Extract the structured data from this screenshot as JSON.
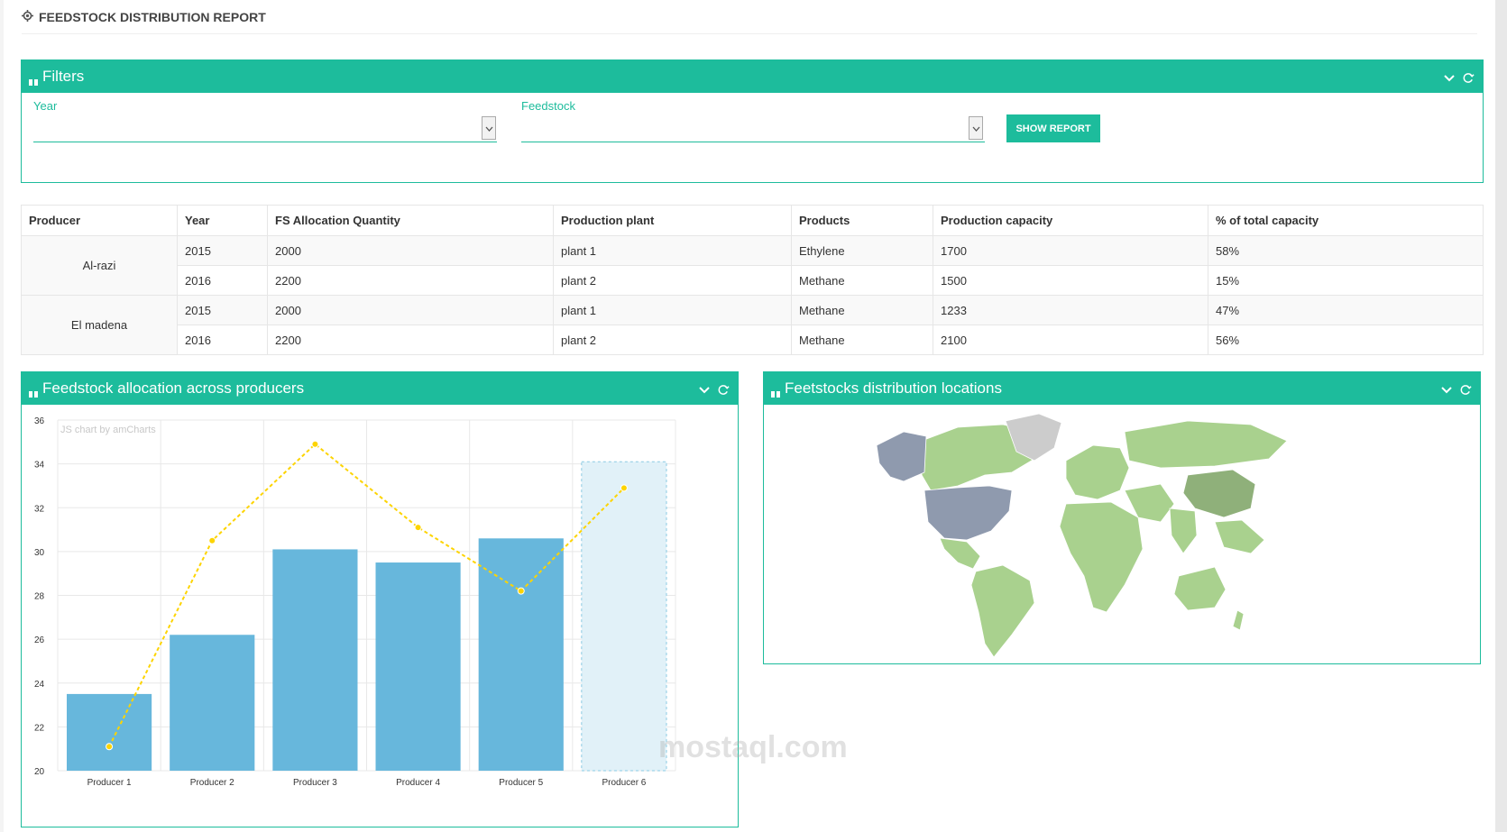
{
  "header": {
    "title": "FEEDSTOCK DISTRIBUTION REPORT"
  },
  "filters": {
    "title": "Filters",
    "year_label": "Year",
    "year_value": "",
    "feedstock_label": "Feedstock",
    "feedstock_value": "",
    "show_button": "SHOW REPORT"
  },
  "table": {
    "columns": [
      "Producer",
      "Year",
      "FS Allocation Quantity",
      "Production plant",
      "Products",
      "Production capacity",
      "% of total capacity"
    ],
    "groups": [
      {
        "producer": "Al-razi",
        "rows": [
          {
            "year": "2015",
            "qty": "2000",
            "plant": "plant 1",
            "product": "Ethylene",
            "capacity": "1700",
            "pct": "58%"
          },
          {
            "year": "2016",
            "qty": "2200",
            "plant": "plant 2",
            "product": "Methane",
            "capacity": "1500",
            "pct": "15%"
          }
        ]
      },
      {
        "producer": "El madena",
        "rows": [
          {
            "year": "2015",
            "qty": "2000",
            "plant": "plant 1",
            "product": "Methane",
            "capacity": "1233",
            "pct": "47%"
          },
          {
            "year": "2016",
            "qty": "2200",
            "plant": "plant 2",
            "product": "Methane",
            "capacity": "2100",
            "pct": "56%"
          }
        ]
      }
    ]
  },
  "chart_panel": {
    "title": "Feedstock allocation across producers"
  },
  "map_panel": {
    "title": "Feetstocks distribution locations"
  },
  "chart_data": {
    "type": "bar",
    "credit": "JS chart by amCharts",
    "categories": [
      "Producer 1",
      "Producer 2",
      "Producer 3",
      "Producer 4",
      "Producer 5",
      "Producer 6"
    ],
    "series": [
      {
        "type": "bar",
        "values": [
          23.5,
          26.2,
          30.1,
          29.5,
          30.6,
          34.1
        ],
        "color": "#67b7dc",
        "highlight_last": true
      },
      {
        "type": "line",
        "values": [
          21.1,
          30.5,
          34.9,
          31.1,
          28.2,
          32.9
        ],
        "color": "#fdd400",
        "dashed": true
      }
    ],
    "ylim": [
      20,
      36
    ],
    "yticks": [
      "20",
      "22",
      "24",
      "26",
      "28",
      "30",
      "32",
      "34",
      "36"
    ],
    "grid": true
  },
  "colors": {
    "accent": "#1dbc9c",
    "bar": "#67b7dc",
    "line": "#fdd400",
    "map_land": "#a9d18e",
    "map_highlight": "#8f9aae",
    "map_grey": "#cccccc"
  },
  "watermark": "mostaql.com"
}
